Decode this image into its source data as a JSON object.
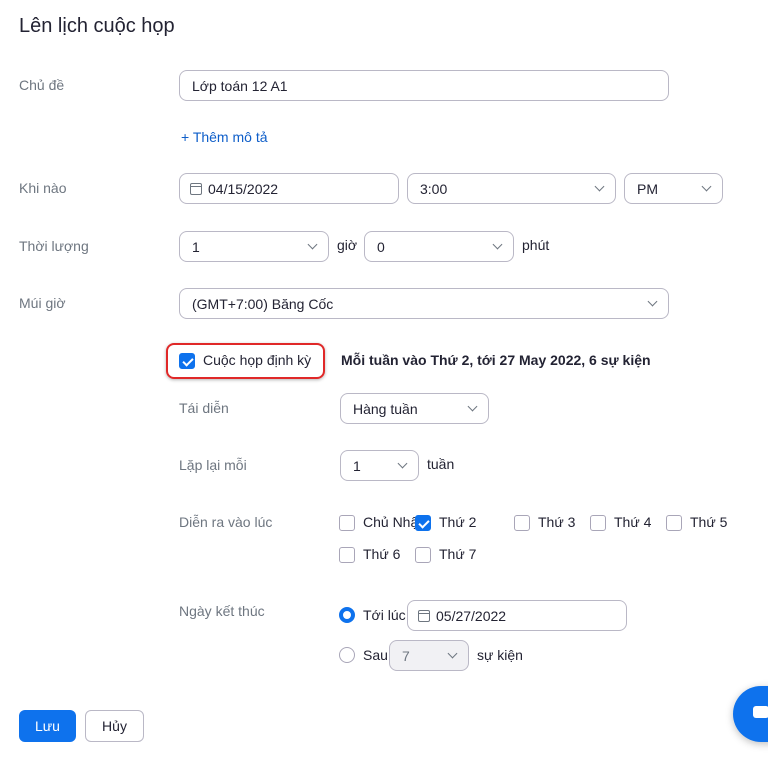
{
  "title": "Lên lịch cuộc họp",
  "topic": {
    "label": "Chủ đề",
    "value": "Lớp toán 12 A1",
    "add_description": "+ Thêm mô tả"
  },
  "when": {
    "label": "Khi nào",
    "date": "04/15/2022",
    "time": "3:00",
    "ampm": "PM"
  },
  "duration": {
    "label": "Thời lượng",
    "hours": "1",
    "hours_unit": "giờ",
    "minutes": "0",
    "minutes_unit": "phút"
  },
  "timezone": {
    "label": "Múi giờ",
    "value": "(GMT+7:00) Băng Cốc"
  },
  "recurring": {
    "label": "Cuộc họp định kỳ",
    "checked": true,
    "summary": "Mỗi tuần vào Thứ 2, tới 27 May 2022, 6 sự kiện",
    "recurrence_label": "Tái diễn",
    "recurrence": "Hàng tuần",
    "repeat_label": "Lặp lại mỗi",
    "repeat_every": "1",
    "repeat_unit": "tuần",
    "occurs_label": "Diễn ra vào lúc",
    "days": [
      {
        "label": "Chủ Nhật",
        "checked": false
      },
      {
        "label": "Thứ 2",
        "checked": true
      },
      {
        "label": "Thứ 3",
        "checked": false
      },
      {
        "label": "Thứ 4",
        "checked": false
      },
      {
        "label": "Thứ 5",
        "checked": false
      },
      {
        "label": "Thứ 6",
        "checked": false
      },
      {
        "label": "Thứ 7",
        "checked": false
      }
    ],
    "end_label": "Ngày kết thúc",
    "end_by_label": "Tới lúc",
    "end_date": "05/27/2022",
    "after_label": "Sau",
    "after_count": "7",
    "after_unit": "sự kiện",
    "selected_end": "by_date"
  },
  "buttons": {
    "save": "Lưu",
    "cancel": "Hủy"
  },
  "colors": {
    "accent": "#0e72ed",
    "highlight": "#e02828"
  }
}
